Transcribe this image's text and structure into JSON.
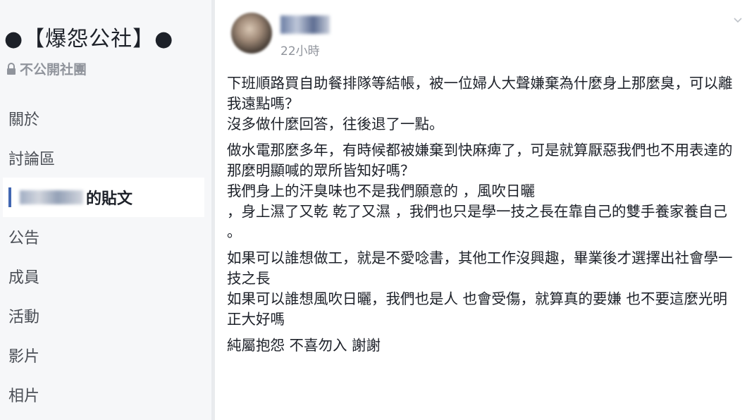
{
  "sidebar": {
    "group_name": "●【爆怨公社】●",
    "privacy_label": "不公開社團",
    "nav": [
      {
        "label": "關於"
      },
      {
        "label": "討論區"
      },
      {
        "label": "的貼文"
      },
      {
        "label": "公告"
      },
      {
        "label": "成員"
      },
      {
        "label": "活動"
      },
      {
        "label": "影片"
      },
      {
        "label": "相片"
      }
    ]
  },
  "post": {
    "timestamp": "22小時",
    "paragraphs": [
      "下班順路買自助餐排隊等結帳，被一位婦人大聲嫌棄為什麼身上那麼臭，可以離我遠點嗎？\n沒多做什麼回答，往後退了一點。",
      "做水電那麼多年，有時候都被嫌棄到快麻痺了，可是就算厭惡我們也不用表達的那麼明顯喊的眾所皆知好嗎？\n我們身上的汗臭味也不是我們願意的 ，風吹日曬\n，身上濕了又乾 乾了又濕 ，我們也只是學一技之長在靠自己的雙手養家養自己 。",
      "如果可以誰想做工，就是不愛唸書，其他工作沒興趣，畢業後才選擇出社會學一技之長\n如果可以誰想風吹日曬，我們也是人 也會受傷，就算真的要嫌 也不要這麼光明正大好嗎",
      "純屬抱怨 不喜勿入 謝謝"
    ]
  },
  "colors": {
    "accent": "#4267b2",
    "sidebar_bg": "#f6f7f9",
    "muted_text": "#90949c"
  }
}
